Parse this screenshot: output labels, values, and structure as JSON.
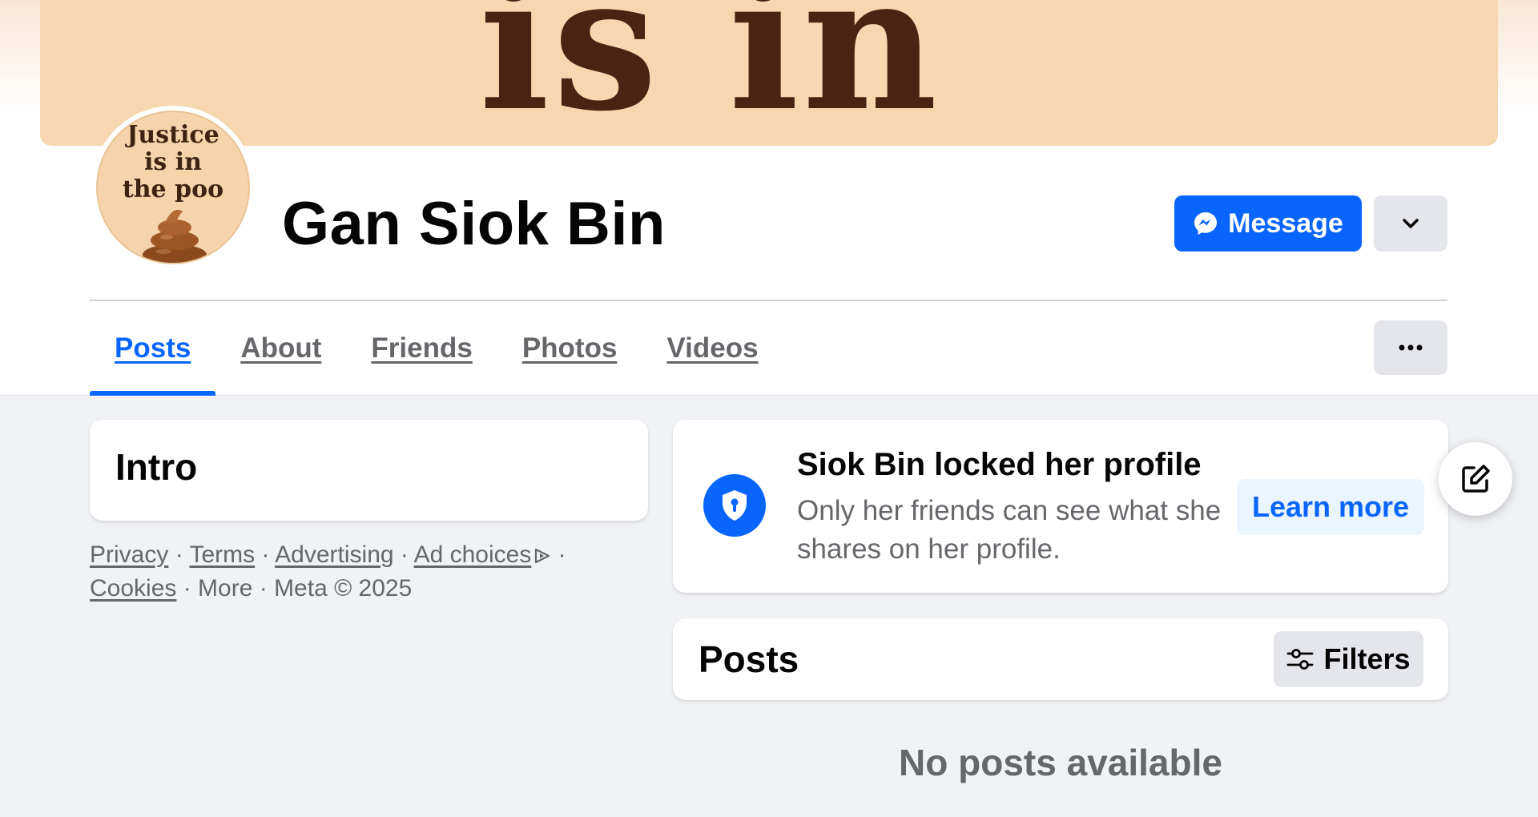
{
  "cover": {
    "text": "is in"
  },
  "avatar": {
    "line1": "Justice",
    "line2": "is in",
    "line3": "the poo"
  },
  "profile": {
    "name": "Gan Siok Bin"
  },
  "actions": {
    "message_label": "Message",
    "message_icon": "messenger-icon",
    "more_icon": "chevron-down-icon"
  },
  "tabs": [
    {
      "label": "Posts",
      "active": true
    },
    {
      "label": "About"
    },
    {
      "label": "Friends"
    },
    {
      "label": "Photos"
    },
    {
      "label": "Videos"
    }
  ],
  "intro": {
    "title": "Intro"
  },
  "footer": {
    "privacy": "Privacy",
    "terms": "Terms",
    "advertising": "Advertising",
    "ad_choices": "Ad choices",
    "cookies": "Cookies",
    "rest": "· More · Meta © 2025"
  },
  "locked": {
    "title": "Siok Bin locked her profile",
    "description": "Only her friends can see what she shares on her profile.",
    "learn_more": "Learn more"
  },
  "posts": {
    "title": "Posts",
    "filters_label": "Filters",
    "empty": "No posts available"
  },
  "colors": {
    "accent": "#0866ff",
    "background": "#f0f2f5",
    "muted_text": "#65676b"
  }
}
